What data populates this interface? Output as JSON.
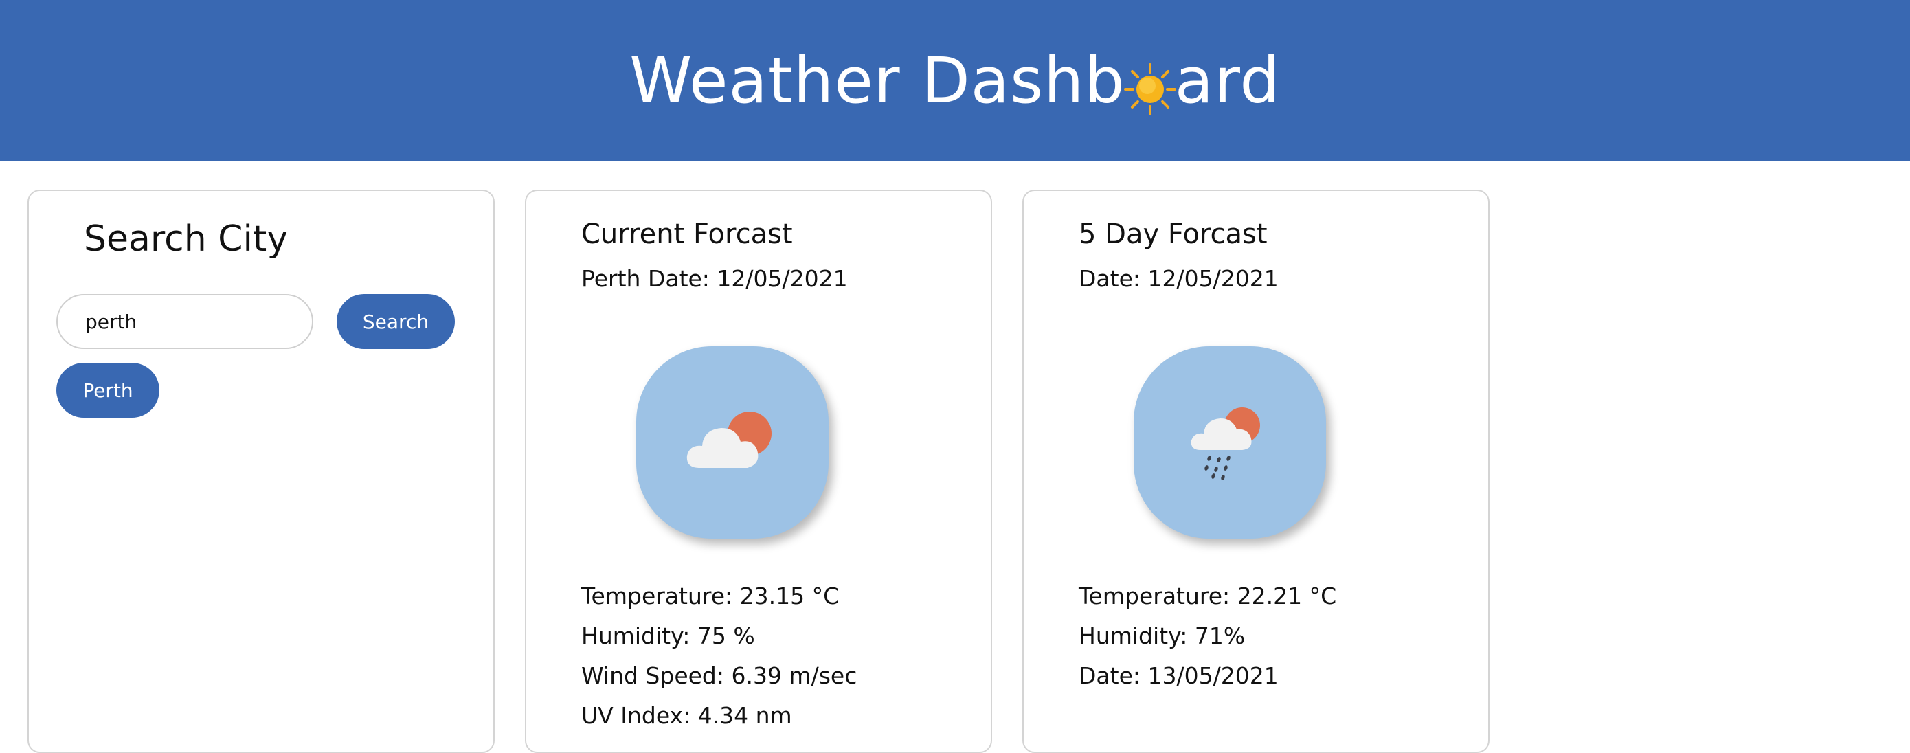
{
  "header": {
    "title_before": "Weather Dashb",
    "title_after": "ard",
    "title_icon": "sun-icon",
    "background": "#3968b2"
  },
  "search": {
    "title": "Search City",
    "input_value": "perth",
    "search_label": "Search",
    "history": [
      "Perth"
    ]
  },
  "current": {
    "title": "Current Forcast",
    "date_line": "Perth Date: 12/05/2021",
    "icon": "cloud-sun-icon",
    "temperature": "Temperature: 23.15 °C",
    "humidity": "Humidity: 75 %",
    "wind": "Wind Speed: 6.39 m/sec",
    "uv": "UV Index: 4.34 nm"
  },
  "five_day": {
    "title": "5 Day Forcast",
    "date_line": "Date: 12/05/2021",
    "icon": "cloud-sun-rain-icon",
    "temperature": "Temperature: 22.21 °C",
    "humidity": "Humidity: 71%",
    "next_date": "Date: 13/05/2021"
  },
  "colors": {
    "accent": "#3968b2",
    "icon_tile": "#9dc2e5",
    "sun": "#e0704f",
    "cloud": "#f2f2f2"
  }
}
